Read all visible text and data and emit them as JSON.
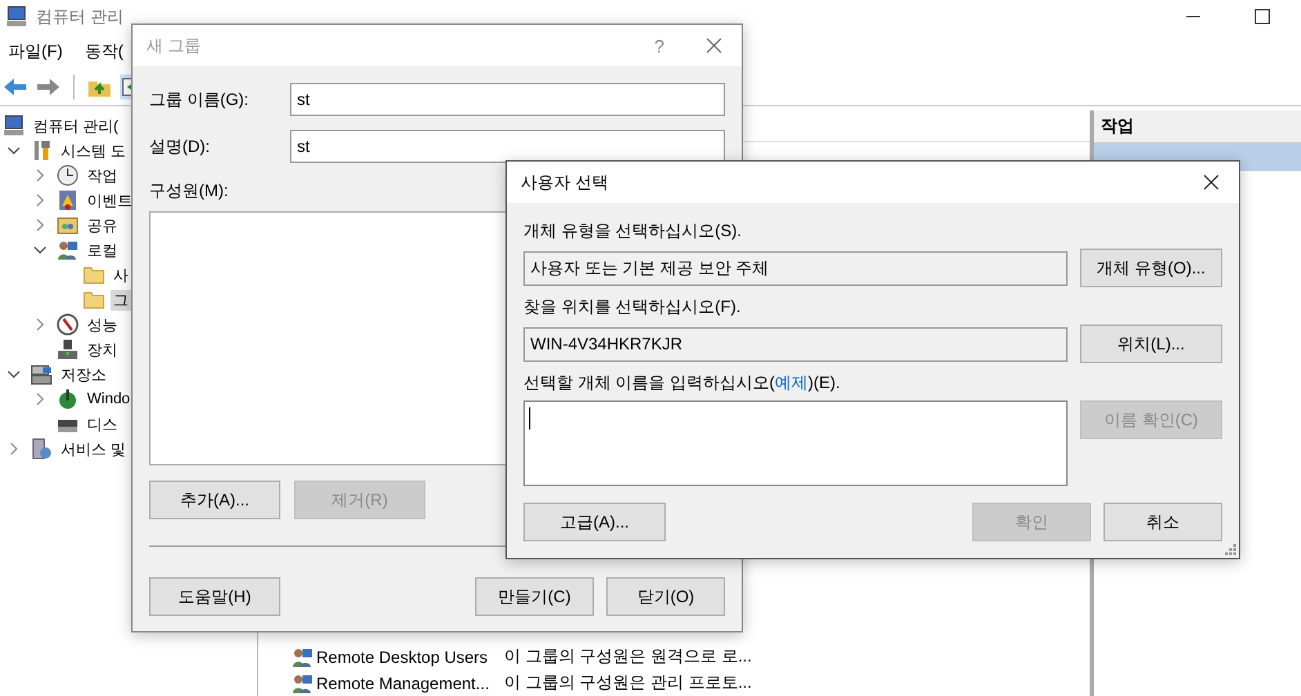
{
  "main_window": {
    "title": "컴퓨터 관리",
    "menu": [
      {
        "label": "파일(F)"
      },
      {
        "label": "동작("
      }
    ],
    "tree": [
      {
        "label": "컴퓨터 관리(",
        "kind": "computer",
        "selected": false,
        "children": [
          {
            "label": "시스템 도",
            "kind": "tools",
            "expanded": true,
            "selected": false,
            "children": [
              {
                "label": "작업",
                "kind": "clock",
                "expanded": false,
                "selected": false
              },
              {
                "label": "이벤트",
                "kind": "event",
                "expanded": false,
                "selected": false
              },
              {
                "label": "공유",
                "kind": "share",
                "expanded": false,
                "selected": false
              },
              {
                "label": "로컬",
                "kind": "users",
                "expanded": true,
                "selected": false,
                "children": [
                  {
                    "label": "사",
                    "kind": "folder",
                    "selected": false
                  },
                  {
                    "label": "그",
                    "kind": "folder",
                    "selected": true
                  }
                ]
              },
              {
                "label": "성능",
                "kind": "perf",
                "expanded": false,
                "selected": false
              },
              {
                "label": "장치",
                "kind": "device",
                "selected": false
              }
            ]
          },
          {
            "label": "저장소",
            "kind": "storage",
            "expanded": true,
            "selected": false,
            "children": [
              {
                "label": "Windo",
                "kind": "backup",
                "expanded": false,
                "selected": false
              },
              {
                "label": "디스",
                "kind": "disk",
                "selected": false
              }
            ]
          },
          {
            "label": "서비스 및",
            "kind": "services",
            "expanded": false,
            "selected": false
          }
        ]
      }
    ],
    "list_rows": [
      {
        "name": "Remote Desktop Users",
        "description": "이 그룹의 구성원은 원격으로 로..."
      },
      {
        "name": "Remote Management...",
        "description": "이 그룹의 구성원은 관리 프로토..."
      }
    ],
    "actions": {
      "header": "작업",
      "items": [
        {
          "selected": true
        }
      ]
    }
  },
  "new_group_dialog": {
    "title": "새 그룹",
    "help": "?",
    "fields": [
      {
        "label": "그룹 이름(G):",
        "value": "st"
      },
      {
        "label": "설명(D):",
        "value": "st"
      }
    ],
    "members_label": "구성원(M):",
    "member_buttons": [
      {
        "label": "추가(A)...",
        "disabled": false
      },
      {
        "label": "제거(R)",
        "disabled": true
      }
    ],
    "footer_left": [
      {
        "label": "도움말(H)",
        "disabled": false
      }
    ],
    "footer_right": [
      {
        "label": "만들기(C)",
        "disabled": false
      },
      {
        "label": "닫기(O)",
        "disabled": false
      }
    ]
  },
  "select_user_dialog": {
    "title": "사용자 선택",
    "sections": [
      {
        "label": "개체 유형을 선택하십시오(S).",
        "value": "사용자 또는 기본 제공 보안 주체",
        "button": {
          "label": "개체 유형(O)...",
          "disabled": false
        }
      },
      {
        "label": "찾을 위치를 선택하십시오(F).",
        "value": "WIN-4V34HKR7KJR",
        "button": {
          "label": "위치(L)...",
          "disabled": false
        }
      }
    ],
    "names_label_before": "선택할 개체 이름을 입력하십시오(",
    "names_link": "예제",
    "names_label_after": ")(E).",
    "names_input": {
      "focused": true
    },
    "check_button": {
      "label": "이름 확인(C)",
      "disabled": true
    },
    "footer_left": [
      {
        "label": "고급(A)...",
        "disabled": false
      }
    ],
    "footer_right": [
      {
        "label": "확인",
        "disabled": true
      },
      {
        "label": "취소",
        "disabled": false
      }
    ]
  }
}
